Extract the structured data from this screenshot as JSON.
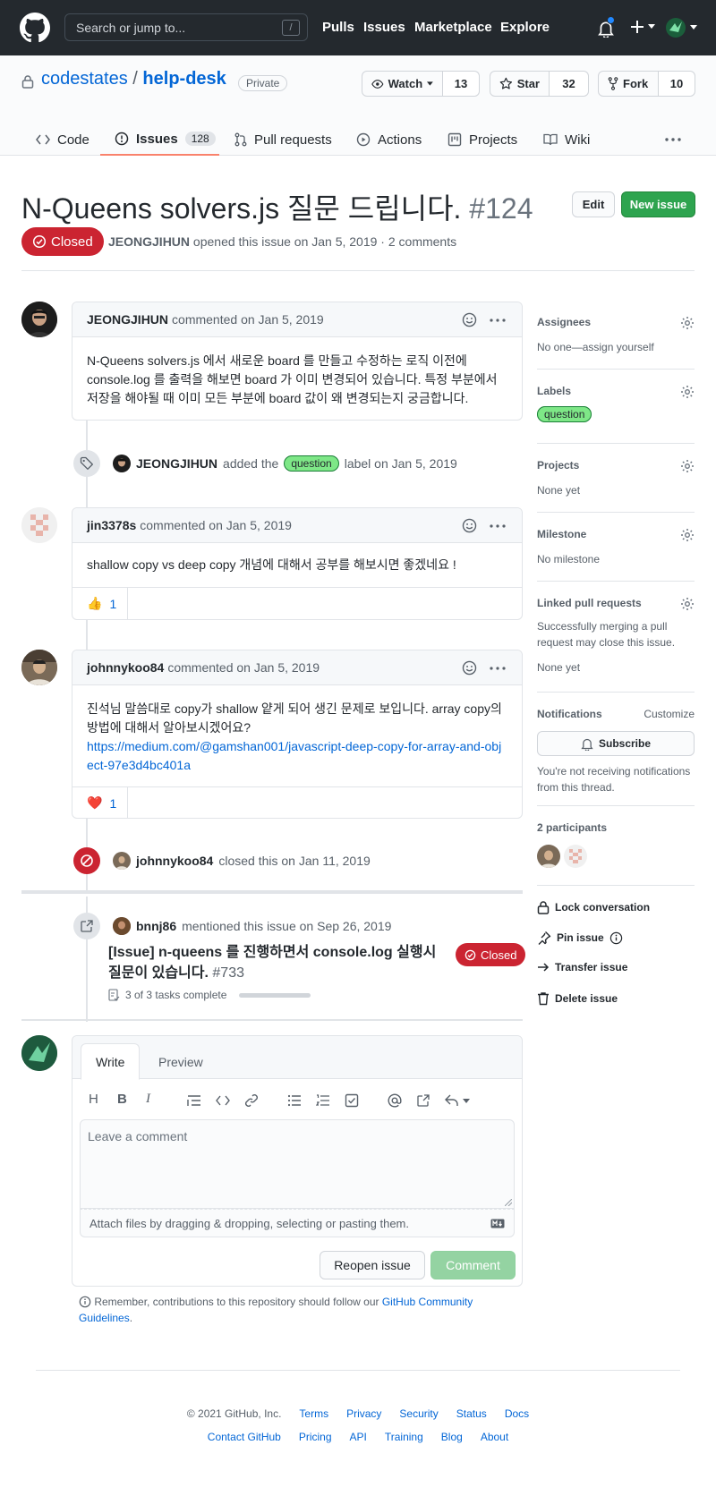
{
  "header": {
    "search_placeholder": "Search or jump to...",
    "slash": "/",
    "nav": [
      "Pulls",
      "Issues",
      "Marketplace",
      "Explore"
    ]
  },
  "repo": {
    "owner": "codestates",
    "sep": "/",
    "name": "help-desk",
    "visibility": "Private",
    "watch_label": "Watch",
    "watch_count": "13",
    "star_label": "Star",
    "star_count": "32",
    "fork_label": "Fork",
    "fork_count": "10"
  },
  "tabs": {
    "code": "Code",
    "issues": "Issues",
    "issues_count": "128",
    "pulls": "Pull requests",
    "actions": "Actions",
    "projects": "Projects",
    "wiki": "Wiki"
  },
  "issue": {
    "title": "N-Queens solvers.js 질문 드립니다.",
    "number": "#124",
    "edit": "Edit",
    "new_issue": "New issue",
    "state": "Closed",
    "author": "JEONGJIHUN",
    "meta_text": "opened this issue on Jan 5, 2019 · 2 comments"
  },
  "comments": [
    {
      "author": "JEONGJIHUN",
      "when": "commented on Jan 5, 2019",
      "body": "N-Queens solvers.js 에서 새로운 board 를 만들고 수정하는 로직 이전에 console.log 를 출력을 해보면 board 가 이미 변경되어 있습니다. 특정 부분에서 저장을 해야될 때 이미 모든 부분에 board 값이 왜 변경되는지 궁금합니다."
    },
    {
      "author": "jin3378s",
      "when": "commented on Jan 5, 2019",
      "body": "shallow copy vs deep copy 개념에 대해서 공부를 해보시면 좋겠네요 !",
      "reaction_emoji": "👍",
      "reaction_count": "1"
    },
    {
      "author": "johnnykoo84",
      "when": "commented on Jan 5, 2019",
      "body": "진석님 말씀대로 copy가 shallow 얕게 되어 생긴 문제로 보입니다. array copy의 방법에 대해서 알아보시겠어요?",
      "link": "https://medium.com/@gamshan001/javascript-deep-copy-for-array-and-object-97e3d4bc401a",
      "reaction_emoji": "❤️",
      "reaction_count": "1"
    }
  ],
  "events": {
    "label_actor": "JEONGJIHUN",
    "label_text": "added the",
    "label_name": "question",
    "label_suffix": "label on Jan 5, 2019",
    "closed_actor": "johnnykoo84",
    "closed_text": "closed this on Jan 11, 2019",
    "mention_actor": "bnnj86",
    "mention_text": "mentioned this issue on Sep 26, 2019",
    "mention_title": "[Issue] n-queens 를 진행하면서 console.log 실행시 질문이 있습니다.",
    "mention_number": "#733",
    "mention_state": "Closed",
    "mention_tasks": "3 of 3 tasks complete",
    "mention_progress": 1.0
  },
  "sidebar": {
    "assignees_title": "Assignees",
    "assignees_value": "No one—assign yourself",
    "labels_title": "Labels",
    "label": "question",
    "projects_title": "Projects",
    "projects_value": "None yet",
    "milestone_title": "Milestone",
    "milestone_value": "No milestone",
    "linked_title": "Linked pull requests",
    "linked_desc": "Successfully merging a pull request may close this issue.",
    "linked_value": "None yet",
    "notifications_title": "Notifications",
    "customize": "Customize",
    "subscribe": "Subscribe",
    "notif_desc": "You're not receiving notifications from this thread.",
    "participants": "2 participants",
    "lock": "Lock conversation",
    "pin": "Pin issue",
    "transfer": "Transfer issue",
    "delete": "Delete issue"
  },
  "form": {
    "write": "Write",
    "preview": "Preview",
    "placeholder": "Leave a comment",
    "attach": "Attach files by dragging & dropping, selecting or pasting them.",
    "reopen": "Reopen issue",
    "comment": "Comment",
    "note_prefix": "Remember, contributions to this repository should follow our",
    "note_link": "GitHub Community Guidelines",
    "note_suffix": "."
  },
  "footer": {
    "copyright": "© 2021 GitHub, Inc.",
    "row1": [
      "Terms",
      "Privacy",
      "Security",
      "Status",
      "Docs"
    ],
    "row2": [
      "Contact GitHub",
      "Pricing",
      "API",
      "Training",
      "Blog",
      "About"
    ]
  },
  "colors": {
    "closed": "#cb2431",
    "green": "#2ea44f",
    "link": "#0366d6",
    "tab_accent": "#f9826c"
  }
}
